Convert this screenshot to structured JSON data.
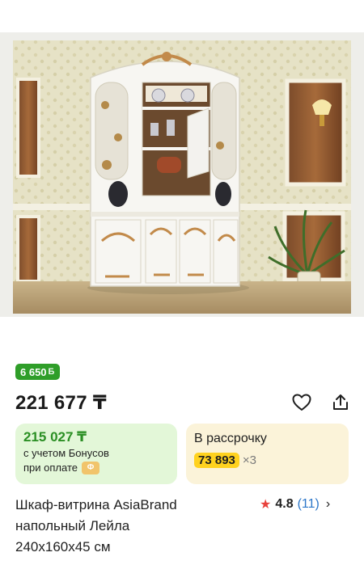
{
  "bonus_badge": {
    "value": "6 650",
    "icon": "Б"
  },
  "price": {
    "main": "221 677 ₸"
  },
  "actions": {
    "favorite_icon": "heart-outline-icon",
    "share_icon": "share-icon"
  },
  "bonus_card": {
    "amount": "215 027 ₸",
    "line1": "с учетом Бонусов",
    "line2": "при оплате",
    "chip": "Ф"
  },
  "installment_card": {
    "title": "В рассрочку",
    "monthly": "73 893",
    "times": "×3"
  },
  "product": {
    "title_lines": [
      "Шкаф-витрина AsiaBrand",
      "напольный Лейла",
      "240x160x45 см"
    ]
  },
  "rating": {
    "score": "4.8",
    "count": "(11)"
  },
  "colors": {
    "bonus_green": "#2f9e29",
    "installment_yellow": "#ffd21f",
    "rating_star": "#e8413c",
    "link_blue": "#2c77c9"
  }
}
